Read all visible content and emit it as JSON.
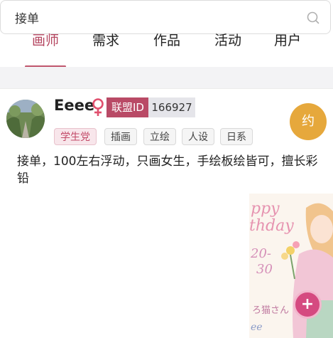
{
  "search": {
    "value": "接单"
  },
  "tabs": [
    {
      "label": "画师",
      "active": true
    },
    {
      "label": "需求"
    },
    {
      "label": "作品"
    },
    {
      "label": "活动"
    },
    {
      "label": "用户"
    }
  ],
  "post": {
    "user_name": "Eeee",
    "gender_symbol": "♀",
    "league_label": "联盟ID",
    "league_id": "166927",
    "book_button": "约",
    "tags": [
      "学生党",
      "插画",
      "立绘",
      "人设",
      "日系"
    ],
    "description": "接单，100左右浮动，只画女生，手绘板绘皆可，擅长彩铅",
    "artwork_text": {
      "line1": "ppy",
      "line2": "thday",
      "line3": "20-",
      "line4": "30",
      "line5": "ろ猫さん",
      "line6": "ee"
    }
  },
  "colors": {
    "accent": "#b4455f",
    "book_button": "#e6a83c",
    "fab": "#d54a80"
  }
}
